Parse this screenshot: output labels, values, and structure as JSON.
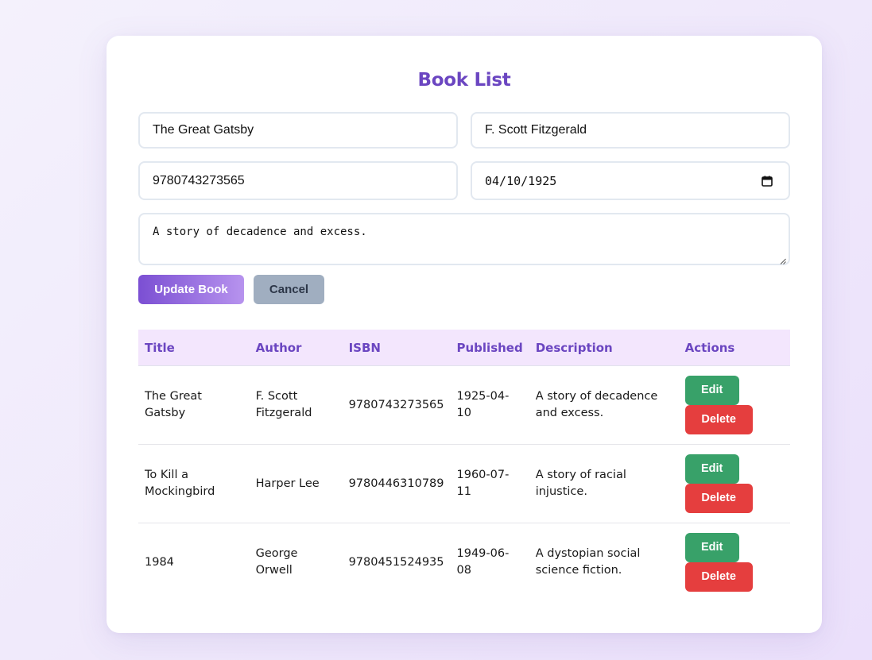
{
  "title": "Book List",
  "form": {
    "title_value": "The Great Gatsby",
    "author_value": "F. Scott Fitzgerald",
    "isbn_value": "9780743273565",
    "date_value": "04/10/1925",
    "description_value": "A story of decadence and excess.",
    "update_label": "Update Book",
    "cancel_label": "Cancel"
  },
  "table": {
    "headers": [
      "Title",
      "Author",
      "ISBN",
      "Published",
      "Description",
      "Actions"
    ],
    "rows": [
      {
        "title": "The Great Gatsby",
        "author": "F. Scott Fitzgerald",
        "isbn": "9780743273565",
        "published": "1925-04-10",
        "description": "A story of decadence and excess."
      },
      {
        "title": "To Kill a Mockingbird",
        "author": "Harper Lee",
        "isbn": "9780446310789",
        "published": "1960-07-11",
        "description": "A story of racial injustice."
      },
      {
        "title": "1984",
        "author": "George Orwell",
        "isbn": "9780451524935",
        "published": "1949-06-08",
        "description": "A dystopian social science fiction."
      }
    ],
    "edit_label": "Edit",
    "delete_label": "Delete"
  },
  "colors": {
    "accent": "#6b46c1",
    "edit": "#38a169",
    "delete": "#e53e3e",
    "cancel": "#a0aec0",
    "header_bg": "#f3e6fd"
  }
}
